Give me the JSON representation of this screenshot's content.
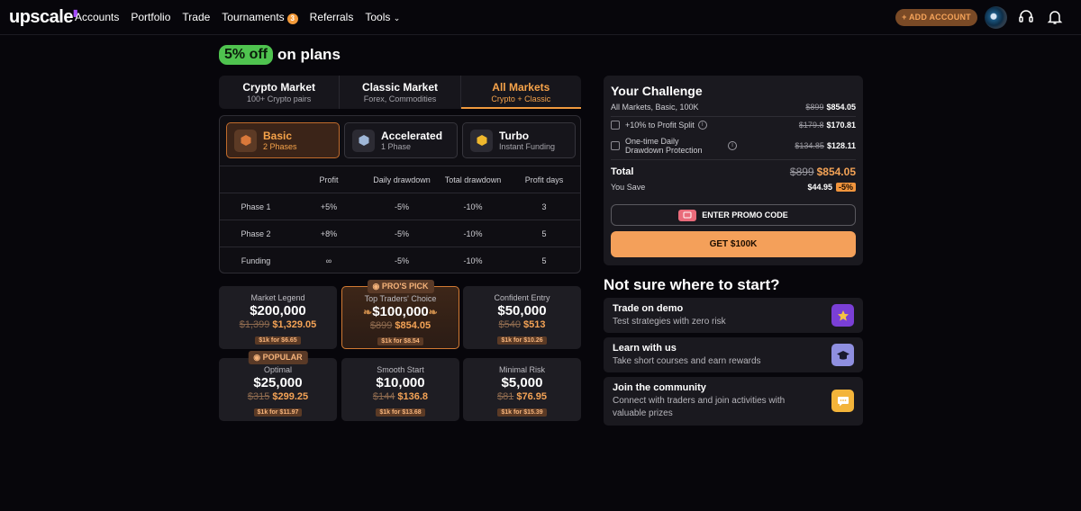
{
  "brand": {
    "name": "upscale"
  },
  "nav": {
    "items": [
      "Accounts",
      "Portfolio",
      "Trade",
      "Tournaments",
      "Referrals",
      "Tools"
    ],
    "tournaments_badge": "3"
  },
  "header": {
    "add_account_label": "+ ADD ACCOUNT"
  },
  "promo": {
    "pill": "5% off",
    "text": "on plans"
  },
  "markets": [
    {
      "title": "Crypto Market",
      "subtitle": "100+ Crypto pairs"
    },
    {
      "title": "Classic Market",
      "subtitle": "Forex, Commodities"
    },
    {
      "title": "All Markets",
      "subtitle": "Crypto + Classic"
    }
  ],
  "plans": [
    {
      "title": "Basic",
      "subtitle": "2 Phases"
    },
    {
      "title": "Accelerated",
      "subtitle": "1 Phase"
    },
    {
      "title": "Turbo",
      "subtitle": "Instant Funding"
    }
  ],
  "rules_table": {
    "headers": [
      "",
      "Profit",
      "Daily drawdown",
      "Total drawdown",
      "Profit days"
    ],
    "rows": [
      [
        "Phase 1",
        "+5%",
        "-5%",
        "-10%",
        "3"
      ],
      [
        "Phase 2",
        "+8%",
        "-5%",
        "-10%",
        "5"
      ],
      [
        "Funding",
        "∞",
        "-5%",
        "-10%",
        "5"
      ]
    ]
  },
  "accounts": [
    {
      "name": "Market Legend",
      "amount": "$200,000",
      "old": "$1,399",
      "price": "$1,329.05",
      "per": "$1k for $6.65"
    },
    {
      "name": "Top Traders' Choice",
      "amount": "$100,000",
      "old": "$899",
      "price": "$854.05",
      "per": "$1k for $8.54",
      "ribbon": "PRO'S PICK"
    },
    {
      "name": "Confident Entry",
      "amount": "$50,000",
      "old": "$540",
      "price": "$513",
      "per": "$1k for $10.26"
    },
    {
      "name": "Optimal",
      "amount": "$25,000",
      "old": "$315",
      "price": "$299.25",
      "per": "$1k for $11.97",
      "ribbon": "POPULAR"
    },
    {
      "name": "Smooth Start",
      "amount": "$10,000",
      "old": "$144",
      "price": "$136.8",
      "per": "$1k for $13.68"
    },
    {
      "name": "Minimal Risk",
      "amount": "$5,000",
      "old": "$81",
      "price": "$76.95",
      "per": "$1k for $15.39"
    }
  ],
  "challenge": {
    "title": "Your Challenge",
    "summary": "All Markets, Basic, 100K",
    "summary_old": "$899",
    "summary_price": "$854.05",
    "addon1_label": "+10% to Profit Split",
    "addon1_old": "$179.8",
    "addon1_price": "$170.81",
    "addon2_label": "One-time Daily Drawdown Protection",
    "addon2_old": "$134.85",
    "addon2_price": "$128.11",
    "total_label": "Total",
    "total_old": "$899",
    "total_price": "$854.05",
    "save_label": "You Save",
    "save_amount": "$44.95",
    "save_pct": "-5%",
    "promo_label": "ENTER PROMO CODE",
    "cta_label": "GET $100K"
  },
  "help": {
    "title": "Not sure where to start?",
    "items": [
      {
        "title": "Trade on demo",
        "desc": "Test strategies with zero risk",
        "icon": "star-icon",
        "color": "#7a3fd6"
      },
      {
        "title": "Learn with us",
        "desc": "Take short courses and earn rewards",
        "icon": "graduation-cap-icon",
        "color": "#8f8fe0"
      },
      {
        "title": "Join the community",
        "desc": "Connect with traders and join activities with valuable prizes",
        "icon": "chat-bubble-icon",
        "color": "#f3b43a"
      }
    ]
  }
}
